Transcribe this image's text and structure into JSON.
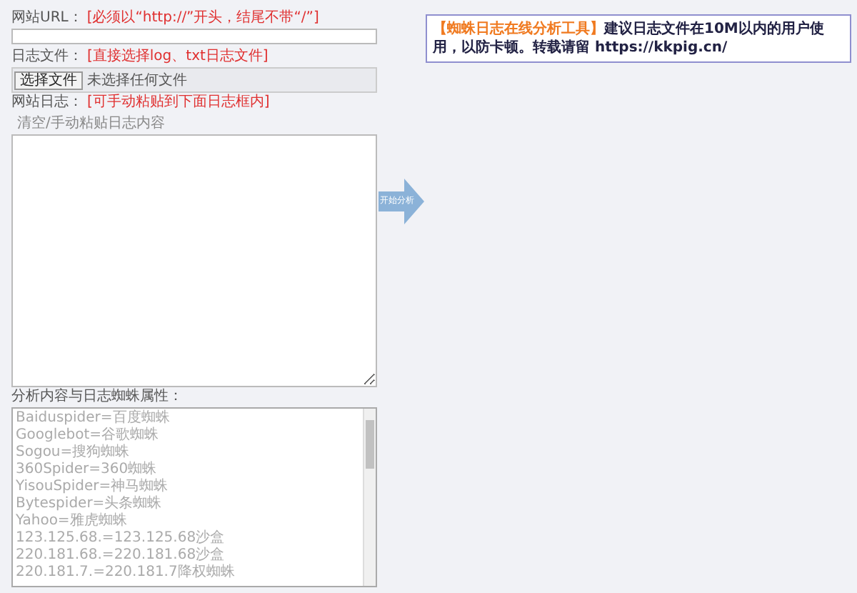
{
  "url_field": {
    "label": "网站URL：",
    "hint": "[必须以“http://”开头，结尾不带“/”]"
  },
  "file_field": {
    "label": "日志文件：",
    "hint": "[直接选择log、txt日志文件]",
    "button": "选择文件",
    "status": "未选择任何文件"
  },
  "log_field": {
    "label": "网站日志：",
    "hint": "[可手动粘贴到下面日志框内]",
    "note": "清空/手动粘贴日志内容"
  },
  "analyze_button": {
    "label": "开始分析"
  },
  "spider_list": {
    "label": "分析内容与日志蜘蛛属性：",
    "lines": [
      "Baiduspider=百度蜘蛛",
      "Googlebot=谷歌蜘蛛",
      "Sogou=搜狗蜘蛛",
      "360Spider=360蜘蛛",
      "YisouSpider=神马蜘蛛",
      "Bytespider=头条蜘蛛",
      "Yahoo=雅虎蜘蛛",
      "123.125.68.=123.125.68沙盒",
      "220.181.68.=220.181.68沙盒",
      "220.181.7.=220.181.7降权蜘蛛"
    ]
  },
  "notice": {
    "title": "【蜘蛛日志在线分析工具】",
    "text": "建议日志文件在10M以内的用户使用，以防卡顿。转载请留 https://kkpig.cn/"
  }
}
